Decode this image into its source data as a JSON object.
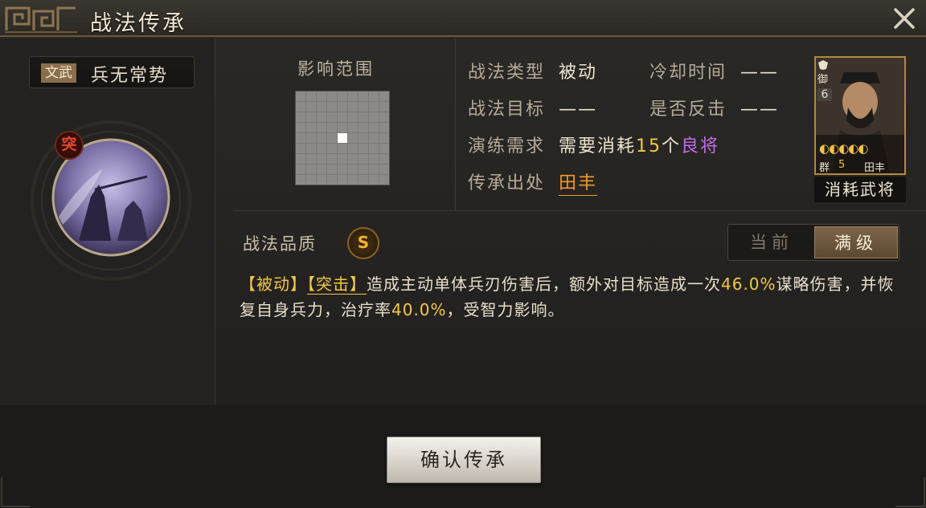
{
  "window": {
    "title": "战法传承",
    "close_icon": "close-icon"
  },
  "skill": {
    "type_tag": "文武",
    "name": "兵无常势",
    "category_badge": "突"
  },
  "range": {
    "title": "影响范围",
    "grid_size": 9
  },
  "info": {
    "type_label": "战法类型",
    "type_value": "被动",
    "cooldown_label": "冷却时间",
    "cooldown_value": "——",
    "target_label": "战法目标",
    "target_value": "——",
    "counter_label": "是否反击",
    "counter_value": "——",
    "drill_label": "演练需求",
    "drill_prefix": "需要消耗",
    "drill_count": "15",
    "drill_unit": "个",
    "drill_quality": "良将",
    "source_label": "传承出处",
    "source_value": "田丰"
  },
  "card": {
    "role": "御",
    "cost": "6",
    "faction": "群",
    "level": "5",
    "name": "田丰",
    "stars": 5,
    "consume_label": "消耗武将"
  },
  "quality": {
    "label": "战法品质",
    "grade": "S"
  },
  "toggle": {
    "current": "当前",
    "max": "满级",
    "selected": "满级"
  },
  "description": {
    "tag1": "【被动】",
    "tag2": "【突击】",
    "part1": "造成主动单体兵刃伤害后，额外对目标造成一次",
    "pct1": "46.0%",
    "part2": "谋略伤害，并恢复自身兵力，治疗率",
    "pct2": "40.0%",
    "part3": "，受智力影响。"
  },
  "confirm_button": "确认传承",
  "colors": {
    "accent_gold": "#f2c84a",
    "quality_purple": "#c06de8",
    "source_orange": "#f29a2c",
    "assault_red": "#e64a2e"
  }
}
